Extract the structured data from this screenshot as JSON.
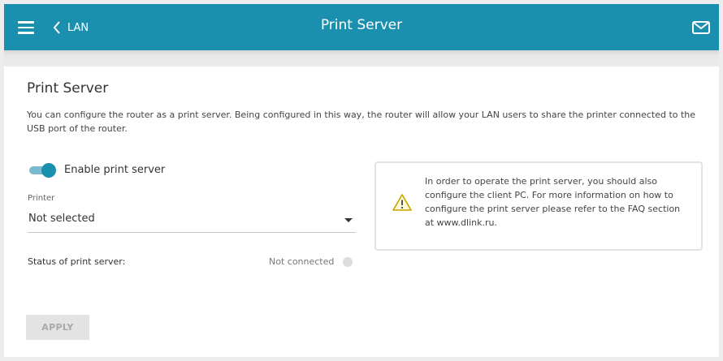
{
  "header": {
    "back_label": "LAN",
    "title": "Print Server",
    "menu_icon": "hamburger-menu-icon",
    "back_icon": "chevron-left-icon",
    "notifications_icon": "mail-icon",
    "color": "#1b8fae"
  },
  "main": {
    "section_title": "Print Server",
    "description": "You can configure the router as a print server. Being configured in this way, the router will allow your LAN users to share the printer connected to the USB port of the router.",
    "enable_toggle": {
      "label": "Enable print server",
      "enabled": true
    },
    "printer": {
      "label": "Printer",
      "value": "Not selected"
    },
    "status": {
      "label": "Status of print server:",
      "value": "Not connected"
    },
    "info_box": {
      "icon": "warning-icon",
      "text": "In order to operate the print server, you should also configure the client PC. For more information on how to configure the print server please refer to the FAQ section at www.dlink.ru."
    },
    "apply_label": "APPLY"
  }
}
